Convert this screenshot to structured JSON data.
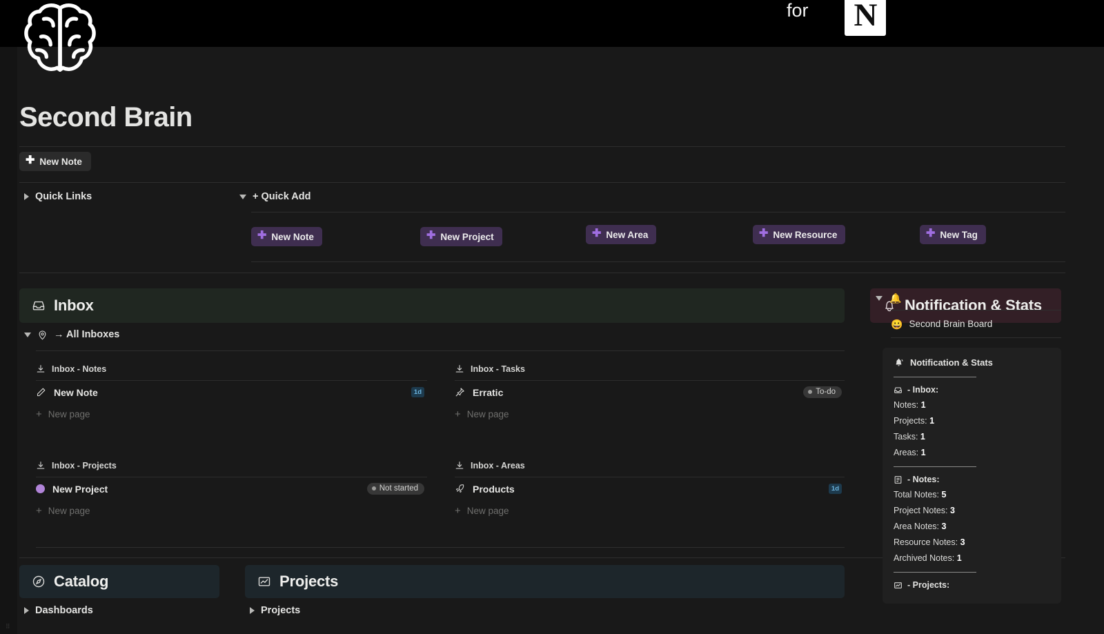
{
  "cover": {
    "for_text": "for",
    "logo_letter": "N",
    "logo_name": "notion-logo"
  },
  "header": {
    "title": "Second Brain",
    "brain_icon": "brain-icon",
    "new_note_label": "New Note"
  },
  "toggles": {
    "quick_links": "Quick Links",
    "quick_add": "+ Quick Add"
  },
  "quick_add_buttons": [
    {
      "label": "New Note"
    },
    {
      "label": "New Project"
    },
    {
      "label": "New Area"
    },
    {
      "label": "New Resource"
    },
    {
      "label": "New Tag"
    }
  ],
  "inbox": {
    "section_title": "Inbox",
    "section_icon": "inbox-tray-icon",
    "all_inboxes_label": "→ All Inboxes",
    "all_inboxes_icon": "map-pin-icon",
    "new_page_label": "New page",
    "groups": [
      {
        "title": "Inbox - Notes",
        "icon": "download-icon",
        "rows": [
          {
            "name": "New Note",
            "icon": "pencil-icon",
            "badge": "1d",
            "badge_type": "date"
          }
        ]
      },
      {
        "title": "Inbox - Tasks",
        "icon": "download-icon",
        "rows": [
          {
            "name": "Erratic",
            "icon": "pin-icon",
            "badge": "To-do",
            "badge_type": "status"
          }
        ]
      },
      {
        "title": "Inbox - Projects",
        "icon": "download-icon",
        "rows": [
          {
            "name": "New Project",
            "icon": "purple-circle-icon",
            "badge": "Not started",
            "badge_type": "status"
          }
        ]
      },
      {
        "title": "Inbox - Areas",
        "icon": "download-icon",
        "rows": [
          {
            "name": "Products",
            "icon": "rocket-icon",
            "badge": "1d",
            "badge_type": "date"
          }
        ]
      }
    ]
  },
  "catalog": {
    "section_title": "Catalog",
    "section_icon": "compass-icon",
    "toggle_label": "Dashboards"
  },
  "projects": {
    "section_title": "Projects",
    "section_icon": "chart-image-icon",
    "toggle_label": "Projects"
  },
  "notifications": {
    "section_title": "Notification & Stats",
    "section_icon": "bell-outline-icon",
    "bell_emoji": "🔔",
    "board_link": "Second Brain Board",
    "board_emoji": "😀",
    "card_title": "Notification & Stats",
    "card_icon": "bell-ring-icon",
    "groups": [
      {
        "heading": "- Inbox:",
        "heading_icon": "inbox-tray-icon",
        "lines": [
          {
            "label": "Notes:",
            "value": "1"
          },
          {
            "label": "Projects:",
            "value": "1"
          },
          {
            "label": "Tasks:",
            "value": "1"
          },
          {
            "label": "Areas:",
            "value": "1"
          }
        ]
      },
      {
        "heading": "- Notes:",
        "heading_icon": "document-icon",
        "lines": [
          {
            "label": "Total Notes:",
            "value": "5"
          },
          {
            "label": "Project Notes:",
            "value": "3"
          },
          {
            "label": "Area Notes:",
            "value": "3"
          },
          {
            "label": "Resource Notes:",
            "value": "3"
          },
          {
            "label": "Archived Notes:",
            "value": "1"
          }
        ]
      },
      {
        "heading": "- Projects:",
        "heading_icon": "chart-image-icon",
        "lines": []
      }
    ]
  },
  "colors": {
    "bg": "#191919",
    "cover": "#000000",
    "accent_purple": "#a06ee1",
    "inbox_header_bg": "#202721",
    "notif_header_bg": "#331f26",
    "catalog_header_bg": "#1d262b",
    "badge_date_bg": "#1d3a4d",
    "badge_date_fg": "#6cb4de"
  }
}
